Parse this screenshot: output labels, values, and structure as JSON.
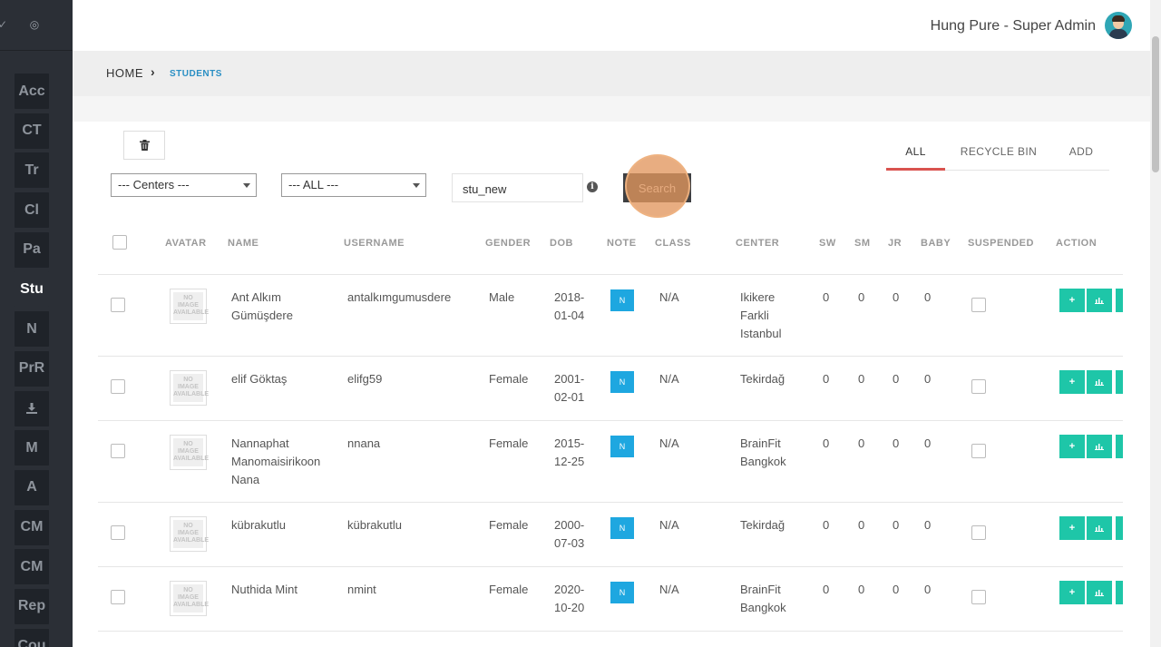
{
  "sidebar": {
    "top_icons": [
      "check-icon",
      "settings-dot-icon"
    ],
    "items": [
      {
        "label": "Acc"
      },
      {
        "label": "CT"
      },
      {
        "label": "Tr"
      },
      {
        "label": "Cl"
      },
      {
        "label": "Pa"
      },
      {
        "label": "Stu",
        "active": true
      },
      {
        "label": "N"
      },
      {
        "label": "PrR"
      },
      {
        "label": "",
        "icon": "download-icon"
      },
      {
        "label": "M"
      },
      {
        "label": "A"
      },
      {
        "label": "CM"
      },
      {
        "label": "CM"
      },
      {
        "label": "Rep"
      },
      {
        "label": "Cou"
      }
    ]
  },
  "header": {
    "user": "Hung Pure - Super Admin"
  },
  "breadcrumb": {
    "home": "HOME",
    "current": "STUDENTS"
  },
  "filters": {
    "centers": "--- Centers ---",
    "all": "--- ALL ---",
    "search_value": "stu_new",
    "search_button": "Search"
  },
  "tabs": [
    {
      "label": "ALL",
      "active": true
    },
    {
      "label": "RECYCLE BIN"
    },
    {
      "label": "ADD"
    }
  ],
  "table": {
    "headers": [
      "AVATAR",
      "NAME",
      "USERNAME",
      "GENDER",
      "DOB",
      "NOTE",
      "CLASS",
      "CENTER",
      "SW",
      "SM",
      "JR",
      "BABY",
      "SUSPENDED",
      "ACTION"
    ],
    "avatar_placeholder": "NO IMAGE AVAILABLE",
    "note_label": "N",
    "rows": [
      {
        "name": "Ant Alkım Gümüşdere",
        "username": "antalkımgumusdere",
        "gender": "Male",
        "dob": "2018-01-04",
        "class": "N/A",
        "center": "Ikikere Farkli Istanbul",
        "sw": "0",
        "sm": "0",
        "jr": "0",
        "baby": "0"
      },
      {
        "name": "elif Göktaş",
        "username": "elifg59",
        "gender": "Female",
        "dob": "2001-02-01",
        "class": "N/A",
        "center": "Tekirdağ",
        "sw": "0",
        "sm": "0",
        "jr": "0",
        "baby": "0"
      },
      {
        "name": "Nannaphat Manomaisirikoon Nana",
        "username": "nnana",
        "gender": "Female",
        "dob": "2015-12-25",
        "class": "N/A",
        "center": "BrainFit Bangkok",
        "sw": "0",
        "sm": "0",
        "jr": "0",
        "baby": "0"
      },
      {
        "name": "kübrakutlu",
        "username": "kübrakutlu",
        "gender": "Female",
        "dob": "2000-07-03",
        "class": "N/A",
        "center": "Tekirdağ",
        "sw": "0",
        "sm": "0",
        "jr": "0",
        "baby": "0"
      },
      {
        "name": "Nuthida Mint",
        "username": "nmint",
        "gender": "Female",
        "dob": "2020-10-20",
        "class": "N/A",
        "center": "BrainFit Bangkok",
        "sw": "0",
        "sm": "0",
        "jr": "0",
        "baby": "0"
      }
    ]
  },
  "colors": {
    "sidebar_bg": "#2b2f36",
    "accent_tab": "#d9534f",
    "note_blue": "#1ea7e0",
    "action_green": "#1ec6a8",
    "breadcrumb_link": "#2a8fc4"
  }
}
